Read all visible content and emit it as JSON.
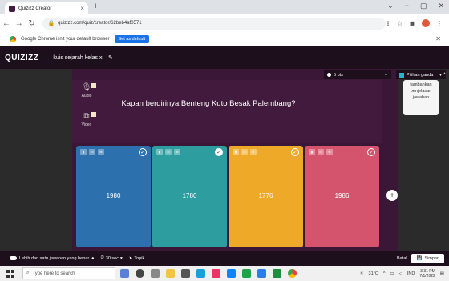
{
  "browser": {
    "tab_title": "Quizizz Creator",
    "tab_close": "×",
    "new_tab": "+",
    "window_controls": [
      "⌄",
      "−",
      "▢",
      "✕"
    ],
    "url": "quizizz.com/quiz/creator/62beb4af0571",
    "infobar_text": "Google Chrome isn't your default browser",
    "infobar_button": "Set as default"
  },
  "app": {
    "logo": "QUIZIZZ",
    "quiz_title": "kuis sejarah kelas xi"
  },
  "editor": {
    "time_select": "5 pts",
    "type_select": "Pilihan ganda",
    "question": "Kapan berdirinya Benteng Kuto Besak Palembang?",
    "media": [
      {
        "label": "Audio"
      },
      {
        "label": "Video"
      }
    ],
    "side_hint": [
      "tambahkan",
      "penjelasan",
      "jawaban"
    ],
    "answers": [
      {
        "text": "1980",
        "correct": false
      },
      {
        "text": "1780",
        "correct": true
      },
      {
        "text": "1776",
        "correct": false
      },
      {
        "text": "1986",
        "correct": false
      }
    ]
  },
  "bottom": {
    "multi_label": "Lebih dari satu jawaban yang benar",
    "time_label": "30 sec",
    "topic_label": "Topik",
    "cancel_label": "Batal",
    "save_label": "Simpan"
  },
  "taskbar": {
    "search_placeholder": "Type here to search",
    "weather": "31°C",
    "lang": "IND",
    "time": "3:31 PM",
    "date": "7/1/2022"
  }
}
